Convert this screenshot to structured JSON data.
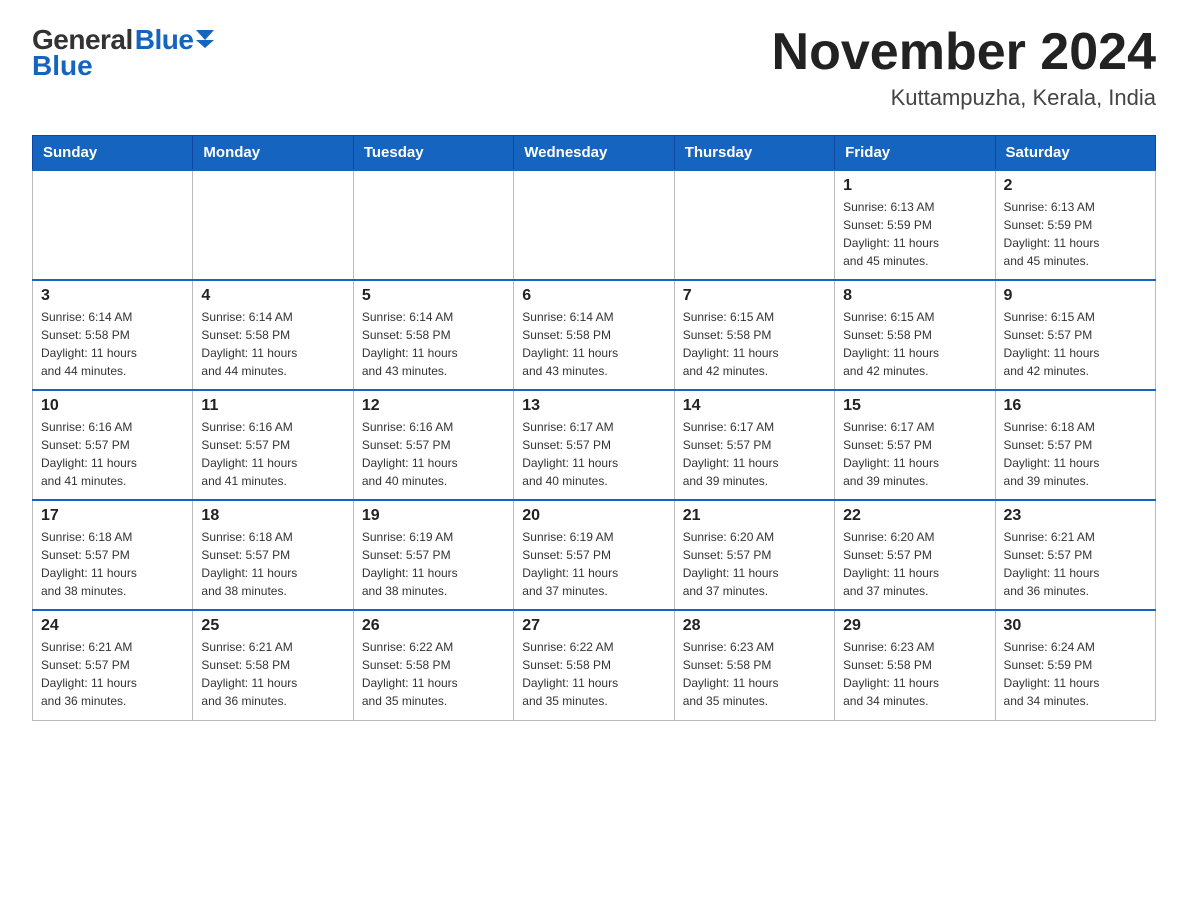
{
  "header": {
    "logo_general": "General",
    "logo_blue": "Blue",
    "month_title": "November 2024",
    "location": "Kuttampuzha, Kerala, India"
  },
  "weekdays": [
    "Sunday",
    "Monday",
    "Tuesday",
    "Wednesday",
    "Thursday",
    "Friday",
    "Saturday"
  ],
  "weeks": [
    [
      {
        "day": "",
        "info": ""
      },
      {
        "day": "",
        "info": ""
      },
      {
        "day": "",
        "info": ""
      },
      {
        "day": "",
        "info": ""
      },
      {
        "day": "",
        "info": ""
      },
      {
        "day": "1",
        "info": "Sunrise: 6:13 AM\nSunset: 5:59 PM\nDaylight: 11 hours\nand 45 minutes."
      },
      {
        "day": "2",
        "info": "Sunrise: 6:13 AM\nSunset: 5:59 PM\nDaylight: 11 hours\nand 45 minutes."
      }
    ],
    [
      {
        "day": "3",
        "info": "Sunrise: 6:14 AM\nSunset: 5:58 PM\nDaylight: 11 hours\nand 44 minutes."
      },
      {
        "day": "4",
        "info": "Sunrise: 6:14 AM\nSunset: 5:58 PM\nDaylight: 11 hours\nand 44 minutes."
      },
      {
        "day": "5",
        "info": "Sunrise: 6:14 AM\nSunset: 5:58 PM\nDaylight: 11 hours\nand 43 minutes."
      },
      {
        "day": "6",
        "info": "Sunrise: 6:14 AM\nSunset: 5:58 PM\nDaylight: 11 hours\nand 43 minutes."
      },
      {
        "day": "7",
        "info": "Sunrise: 6:15 AM\nSunset: 5:58 PM\nDaylight: 11 hours\nand 42 minutes."
      },
      {
        "day": "8",
        "info": "Sunrise: 6:15 AM\nSunset: 5:58 PM\nDaylight: 11 hours\nand 42 minutes."
      },
      {
        "day": "9",
        "info": "Sunrise: 6:15 AM\nSunset: 5:57 PM\nDaylight: 11 hours\nand 42 minutes."
      }
    ],
    [
      {
        "day": "10",
        "info": "Sunrise: 6:16 AM\nSunset: 5:57 PM\nDaylight: 11 hours\nand 41 minutes."
      },
      {
        "day": "11",
        "info": "Sunrise: 6:16 AM\nSunset: 5:57 PM\nDaylight: 11 hours\nand 41 minutes."
      },
      {
        "day": "12",
        "info": "Sunrise: 6:16 AM\nSunset: 5:57 PM\nDaylight: 11 hours\nand 40 minutes."
      },
      {
        "day": "13",
        "info": "Sunrise: 6:17 AM\nSunset: 5:57 PM\nDaylight: 11 hours\nand 40 minutes."
      },
      {
        "day": "14",
        "info": "Sunrise: 6:17 AM\nSunset: 5:57 PM\nDaylight: 11 hours\nand 39 minutes."
      },
      {
        "day": "15",
        "info": "Sunrise: 6:17 AM\nSunset: 5:57 PM\nDaylight: 11 hours\nand 39 minutes."
      },
      {
        "day": "16",
        "info": "Sunrise: 6:18 AM\nSunset: 5:57 PM\nDaylight: 11 hours\nand 39 minutes."
      }
    ],
    [
      {
        "day": "17",
        "info": "Sunrise: 6:18 AM\nSunset: 5:57 PM\nDaylight: 11 hours\nand 38 minutes."
      },
      {
        "day": "18",
        "info": "Sunrise: 6:18 AM\nSunset: 5:57 PM\nDaylight: 11 hours\nand 38 minutes."
      },
      {
        "day": "19",
        "info": "Sunrise: 6:19 AM\nSunset: 5:57 PM\nDaylight: 11 hours\nand 38 minutes."
      },
      {
        "day": "20",
        "info": "Sunrise: 6:19 AM\nSunset: 5:57 PM\nDaylight: 11 hours\nand 37 minutes."
      },
      {
        "day": "21",
        "info": "Sunrise: 6:20 AM\nSunset: 5:57 PM\nDaylight: 11 hours\nand 37 minutes."
      },
      {
        "day": "22",
        "info": "Sunrise: 6:20 AM\nSunset: 5:57 PM\nDaylight: 11 hours\nand 37 minutes."
      },
      {
        "day": "23",
        "info": "Sunrise: 6:21 AM\nSunset: 5:57 PM\nDaylight: 11 hours\nand 36 minutes."
      }
    ],
    [
      {
        "day": "24",
        "info": "Sunrise: 6:21 AM\nSunset: 5:57 PM\nDaylight: 11 hours\nand 36 minutes."
      },
      {
        "day": "25",
        "info": "Sunrise: 6:21 AM\nSunset: 5:58 PM\nDaylight: 11 hours\nand 36 minutes."
      },
      {
        "day": "26",
        "info": "Sunrise: 6:22 AM\nSunset: 5:58 PM\nDaylight: 11 hours\nand 35 minutes."
      },
      {
        "day": "27",
        "info": "Sunrise: 6:22 AM\nSunset: 5:58 PM\nDaylight: 11 hours\nand 35 minutes."
      },
      {
        "day": "28",
        "info": "Sunrise: 6:23 AM\nSunset: 5:58 PM\nDaylight: 11 hours\nand 35 minutes."
      },
      {
        "day": "29",
        "info": "Sunrise: 6:23 AM\nSunset: 5:58 PM\nDaylight: 11 hours\nand 34 minutes."
      },
      {
        "day": "30",
        "info": "Sunrise: 6:24 AM\nSunset: 5:59 PM\nDaylight: 11 hours\nand 34 minutes."
      }
    ]
  ]
}
